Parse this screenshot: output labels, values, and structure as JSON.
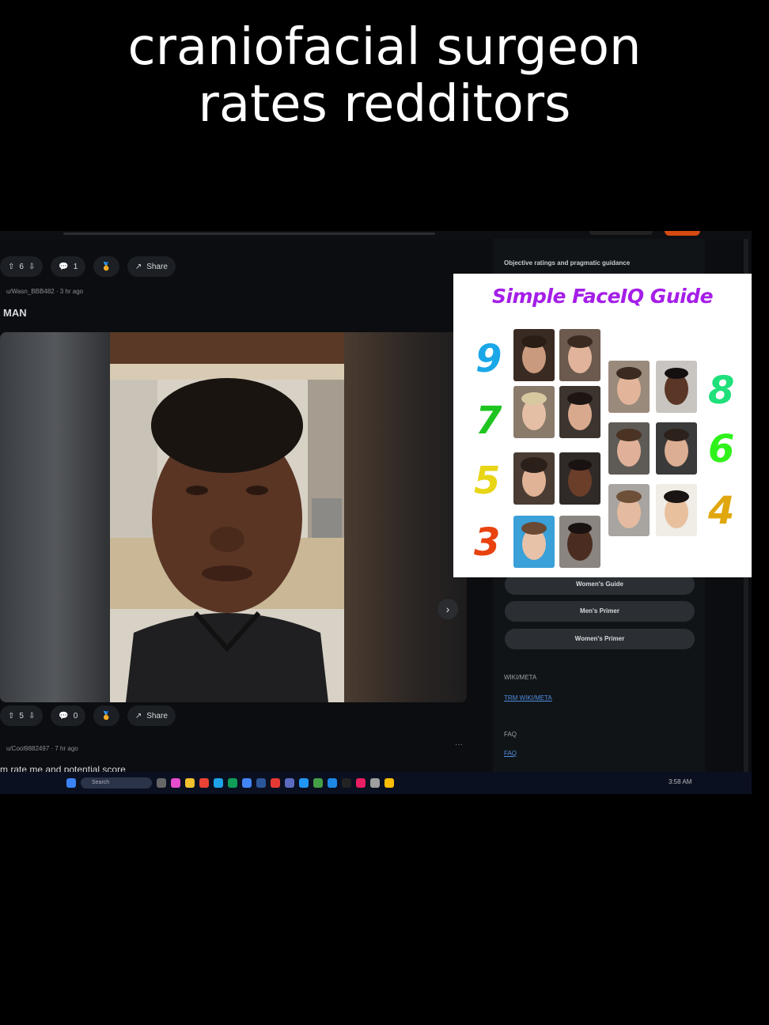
{
  "caption": {
    "line1": "craniofacial surgeon",
    "line2": "rates redditors"
  },
  "colors": {
    "page_bg": "#000000",
    "reddit_bg": "#0b0d10",
    "sidebar_bg": "#111417",
    "link": "#4f8ee0",
    "guide_title": "#a51ee8",
    "taskbar": "#0a1020"
  },
  "feed": {
    "top_actions": {
      "vote_count": "6",
      "comment_count": "1",
      "share_label": "Share"
    },
    "post": {
      "author": "u/Wasn_BBB482 · 3 hr ago",
      "title": "MAN"
    },
    "bottom_actions": {
      "vote_count": "5",
      "comment_count": "0",
      "share_label": "Share"
    },
    "comment": {
      "author": "u/Cool9882497 · 7 hr ago",
      "more": "···",
      "text": "m rate me and potential score"
    }
  },
  "sidebar": {
    "description": "Objective ratings and pragmatic guidance",
    "buttons": [
      "Women's Guide",
      "Men's Primer",
      "Women's Primer"
    ],
    "sections": [
      {
        "heading": "WIKI/META",
        "link": "TRM WIKI/META"
      },
      {
        "heading": "FAQ",
        "link": "FAQ"
      }
    ]
  },
  "guide": {
    "title": "Simple FaceIQ Guide",
    "left_scores": [
      {
        "value": "9",
        "color": "#1aa7e8"
      },
      {
        "value": "7",
        "color": "#1fc41f"
      },
      {
        "value": "5",
        "color": "#e8d516"
      },
      {
        "value": "3",
        "color": "#e8420f"
      }
    ],
    "right_scores": [
      {
        "value": "8",
        "color": "#1fe07a"
      },
      {
        "value": "6",
        "color": "#2ff21a"
      },
      {
        "value": "4",
        "color": "#e0a70e"
      }
    ]
  },
  "taskbar": {
    "search_placeholder": "Search",
    "tray_time": "3:58 AM"
  }
}
